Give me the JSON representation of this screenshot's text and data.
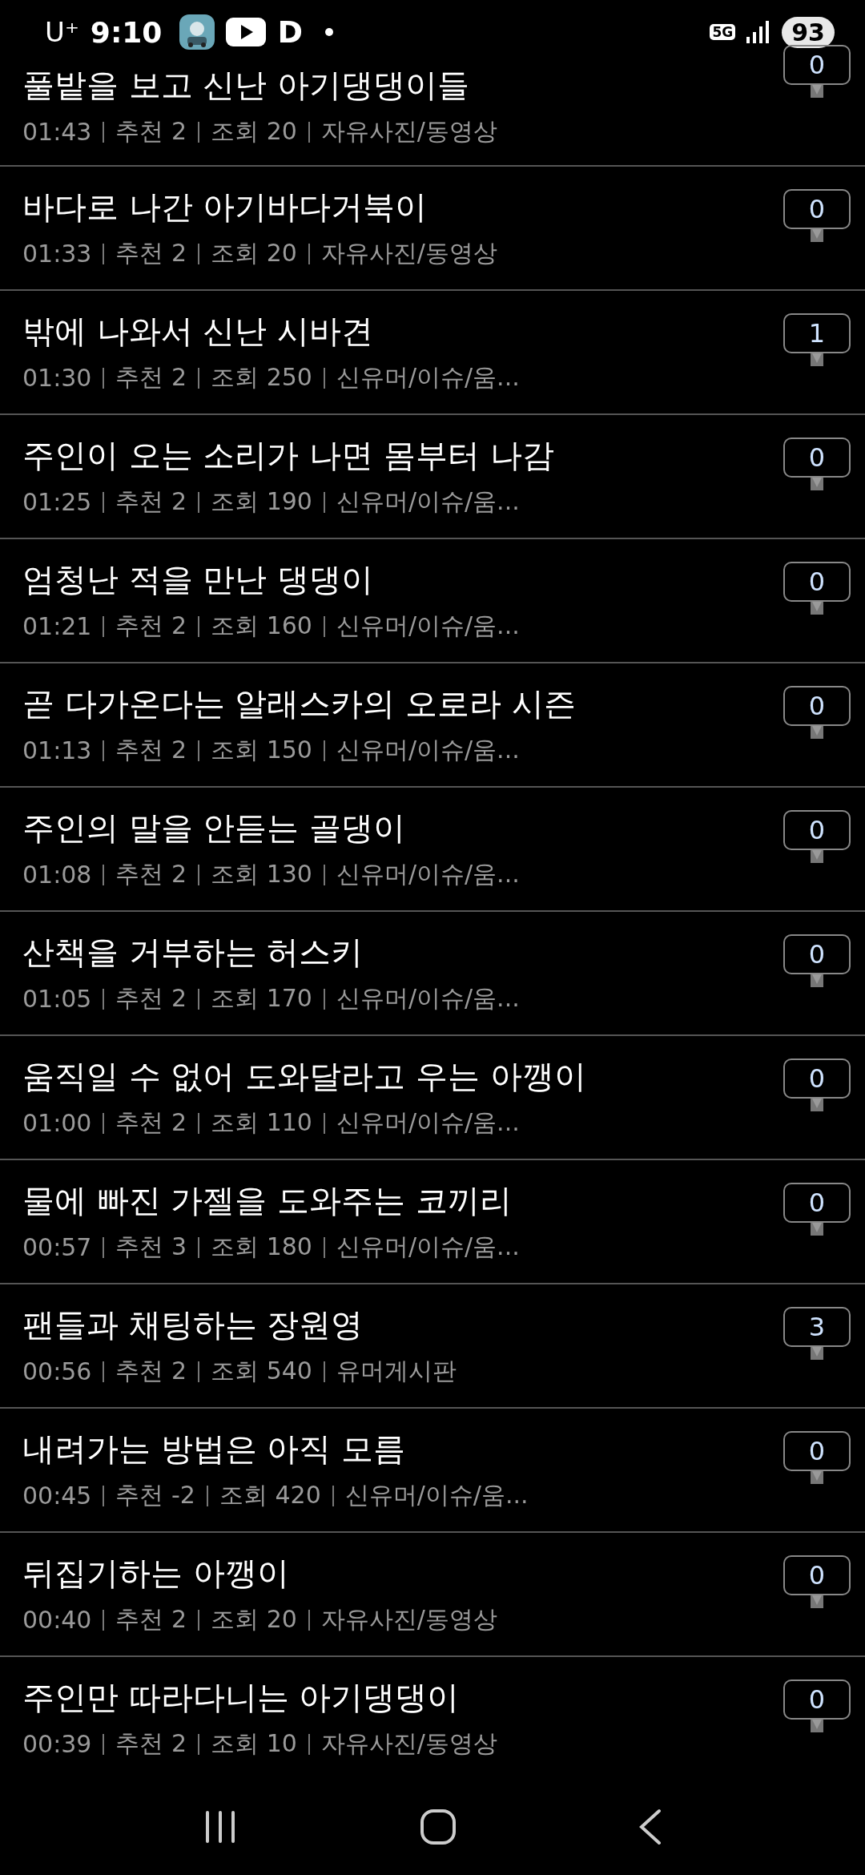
{
  "status_bar": {
    "carrier": "U⁺",
    "time": "9:10",
    "app_letter": "D",
    "network": "5G",
    "battery": "93"
  },
  "posts": [
    {
      "title": "풀밭을 보고 신난 아기댕댕이들",
      "time": "01:43",
      "likes": "추천 2",
      "views": "조회 20",
      "category": "자유사진/동영상",
      "comments": "0"
    },
    {
      "title": "바다로 나간 아기바다거북이",
      "time": "01:33",
      "likes": "추천 2",
      "views": "조회 20",
      "category": "자유사진/동영상",
      "comments": "0"
    },
    {
      "title": "밖에 나와서 신난 시바견",
      "time": "01:30",
      "likes": "추천 2",
      "views": "조회 250",
      "category": "신유머/이슈/움...",
      "comments": "1"
    },
    {
      "title": "주인이 오는 소리가 나면 몸부터 나감",
      "time": "01:25",
      "likes": "추천 2",
      "views": "조회 190",
      "category": "신유머/이슈/움...",
      "comments": "0"
    },
    {
      "title": "엄청난 적을 만난 댕댕이",
      "time": "01:21",
      "likes": "추천 2",
      "views": "조회 160",
      "category": "신유머/이슈/움...",
      "comments": "0"
    },
    {
      "title": "곧 다가온다는 알래스카의 오로라 시즌",
      "time": "01:13",
      "likes": "추천 2",
      "views": "조회 150",
      "category": "신유머/이슈/움...",
      "comments": "0"
    },
    {
      "title": "주인의 말을 안듣는 골댕이",
      "time": "01:08",
      "likes": "추천 2",
      "views": "조회 130",
      "category": "신유머/이슈/움...",
      "comments": "0"
    },
    {
      "title": "산책을 거부하는 허스키",
      "time": "01:05",
      "likes": "추천 2",
      "views": "조회 170",
      "category": "신유머/이슈/움...",
      "comments": "0"
    },
    {
      "title": "움직일 수 없어 도와달라고 우는 아깽이",
      "time": "01:00",
      "likes": "추천 2",
      "views": "조회 110",
      "category": "신유머/이슈/움...",
      "comments": "0"
    },
    {
      "title": "물에 빠진 가젤을 도와주는 코끼리",
      "time": "00:57",
      "likes": "추천 3",
      "views": "조회 180",
      "category": "신유머/이슈/움...",
      "comments": "0"
    },
    {
      "title": "팬들과 채팅하는 장원영",
      "time": "00:56",
      "likes": "추천 2",
      "views": "조회 540",
      "category": "유머게시판",
      "comments": "3"
    },
    {
      "title": "내려가는 방법은 아직 모름",
      "time": "00:45",
      "likes": "추천 -2",
      "views": "조회 420",
      "category": "신유머/이슈/움...",
      "comments": "0"
    },
    {
      "title": "뒤집기하는 아깽이",
      "time": "00:40",
      "likes": "추천 2",
      "views": "조회 20",
      "category": "자유사진/동영상",
      "comments": "0"
    },
    {
      "title": "주인만 따라다니는 아기댕댕이",
      "time": "00:39",
      "likes": "추천 2",
      "views": "조회 10",
      "category": "자유사진/동영상",
      "comments": "0"
    }
  ]
}
